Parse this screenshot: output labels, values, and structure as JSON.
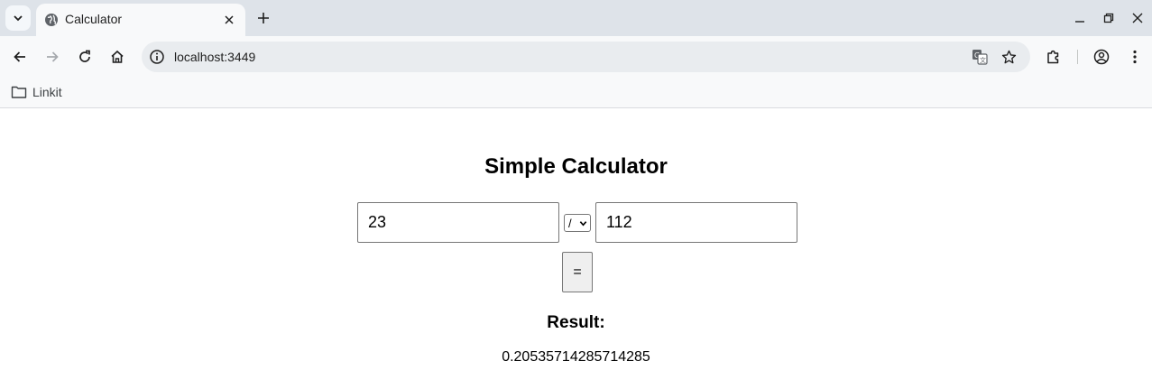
{
  "browser": {
    "tab": {
      "title": "Calculator"
    },
    "address_bar": {
      "url": "localhost:3449"
    },
    "bookmarks": [
      {
        "label": "Linkit"
      }
    ]
  },
  "calculator": {
    "heading": "Simple Calculator",
    "operand1": "23",
    "operator": "/",
    "operand2": "112",
    "equals_label": "=",
    "result_label": "Result:",
    "result_value": "0.20535714285714285"
  }
}
